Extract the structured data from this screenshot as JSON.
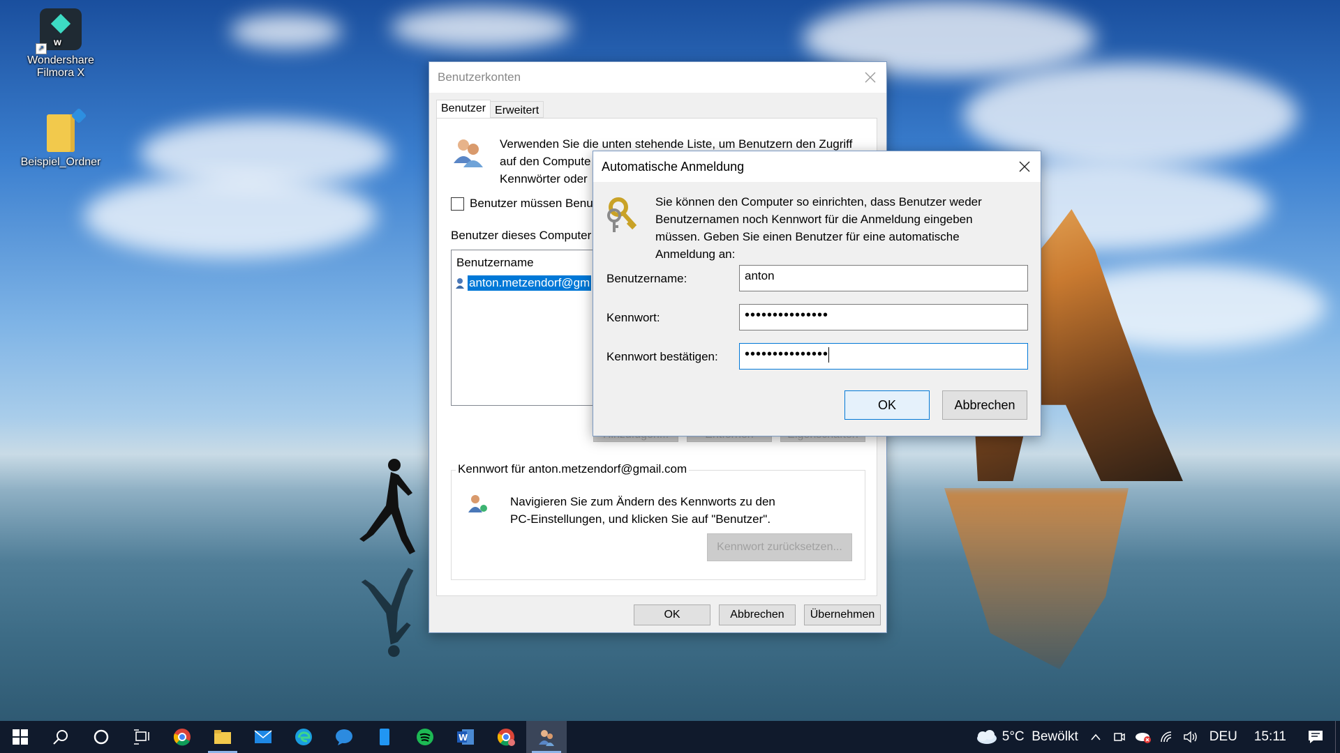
{
  "desktop": {
    "icons": [
      {
        "label": "Wondershare Filmora X"
      },
      {
        "label": "Beispiel_Ordner"
      }
    ]
  },
  "main_dialog": {
    "title": "Benutzerkonten",
    "tabs": [
      {
        "label": "Benutzer"
      },
      {
        "label": "Erweitert"
      }
    ],
    "intro_text": "Verwenden Sie die unten stehende Liste, um Benutzern den Zugriff auf den Computer zu gewähren oder zu verweigern und um Kennwörter oder andere Einstellungen zu ändern.",
    "intro_line1": "Verwenden Sie die unten stehende Liste, um Benutzern den Zugriff",
    "intro_line2": "auf den Compute",
    "intro_line3": "Kennwörter oder",
    "checkbox_label": "Benutzer müssen Benu",
    "users_section_label": "Benutzer dieses Computer",
    "list_header": "Benutzername",
    "list_selected_user": "anton.metzendorf@gm",
    "hidden_buttons": [
      "Hinzufügen...",
      "Entfernen",
      "Eigenschaften"
    ],
    "password_group_title": "Kennwort für anton.metzendorf@gmail.com",
    "password_text_line1": "Navigieren Sie zum Ändern des Kennworts zu den",
    "password_text_line2": "PC-Einstellungen, und klicken Sie auf \"Benutzer\".",
    "reset_button": "Kennwort zurücksetzen...",
    "ok_button": "OK",
    "cancel_button": "Abbrechen",
    "apply_button": "Übernehmen"
  },
  "auto_login_dialog": {
    "title": "Automatische Anmeldung",
    "description_line1": "Sie können den Computer so einrichten, dass Benutzer weder",
    "description_line2": "Benutzernamen noch Kennwort für die Anmeldung eingeben",
    "description_line3": "müssen. Geben Sie einen Benutzer für eine automatische",
    "description_line4": "Anmeldung an:",
    "username_label": "Benutzername:",
    "username_value": "anton",
    "password_label": "Kennwort:",
    "password_value": "•••••••••••••••",
    "confirm_label": "Kennwort bestätigen:",
    "confirm_value": "•••••••••••••••",
    "ok_button": "OK",
    "cancel_button": "Abbrechen"
  },
  "taskbar": {
    "weather": "5°C  Bewölkt",
    "language": "DEU",
    "time": "15:11"
  }
}
